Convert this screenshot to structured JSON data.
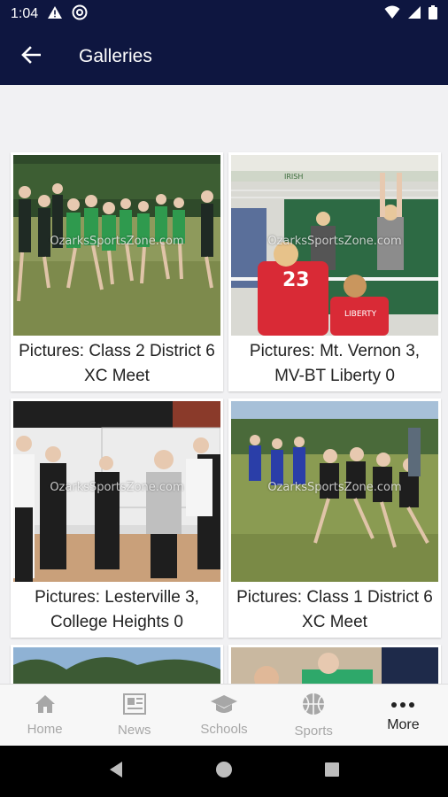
{
  "status_bar": {
    "time": "1:04",
    "icons": [
      "warning-icon",
      "at-sign-icon",
      "wifi-icon",
      "signal-icon",
      "battery-icon"
    ]
  },
  "app_bar": {
    "back_icon": "arrow-left-icon",
    "title": "Galleries"
  },
  "galleries": [
    {
      "caption": "Pictures: Class 2 District 6 XC Meet",
      "watermark": "OzarksSportsZone.com"
    },
    {
      "caption": "Pictures: Mt. Vernon 3, MV-BT Liberty 0",
      "watermark": "OzarksSportsZone.com",
      "jersey_number": "23",
      "jersey_text": "LIBERTY",
      "score_text": "IRISH"
    },
    {
      "caption": "Pictures: Lesterville 3, College Heights 0",
      "watermark": "OzarksSportsZone.com"
    },
    {
      "caption": "Pictures: Class 1 District 6 XC Meet",
      "watermark": "OzarksSportsZone.com"
    }
  ],
  "bottom_nav": [
    {
      "label": "Home",
      "icon": "home-icon",
      "active": false
    },
    {
      "label": "News",
      "icon": "newspaper-icon",
      "active": false
    },
    {
      "label": "Schools",
      "icon": "graduation-cap-icon",
      "active": false
    },
    {
      "label": "Sports",
      "icon": "basketball-icon",
      "active": false
    },
    {
      "label": "More",
      "icon": "more-dots-icon",
      "active": true
    }
  ],
  "colors": {
    "app_bar": "#0e1640",
    "background": "#f1f1f3",
    "nav_inactive": "#a7a7a7",
    "nav_active": "#222222"
  }
}
